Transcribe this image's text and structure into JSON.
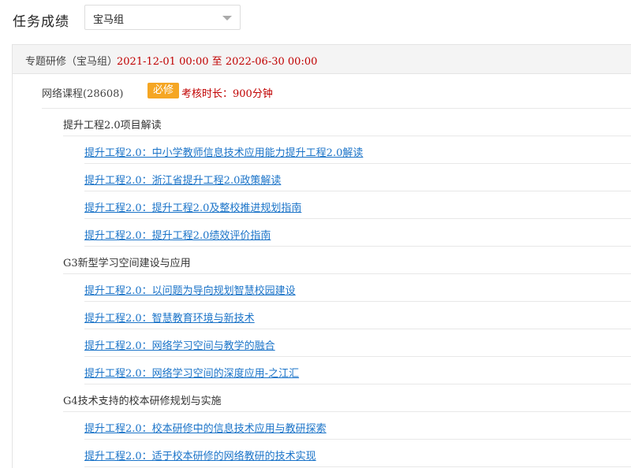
{
  "header": {
    "title": "任务成绩",
    "group_select": {
      "value": "宝马组"
    }
  },
  "project": {
    "label": "专题研修（宝马组）",
    "date_range": "2021-12-01 00:00 至 2022-06-30 00:00",
    "course": {
      "name": "网络课程(28608)",
      "badge": "必修",
      "assessment": "考核时长：900分钟"
    },
    "groups": [
      {
        "title": "提升工程2.0项目解读",
        "lessons": [
          "提升工程2.0：中小学教师信息技术应用能力提升工程2.0解读",
          "提升工程2.0：浙江省提升工程2.0政策解读",
          "提升工程2.0：提升工程2.0及整校推进规划指南",
          "提升工程2.0：提升工程2.0绩效评价指南"
        ]
      },
      {
        "title": "G3新型学习空间建设与应用",
        "lessons": [
          "提升工程2.0：以问题为导向规划智慧校园建设",
          "提升工程2.0：智慧教育环境与新技术",
          "提升工程2.0：网络学习空间与教学的融合",
          "提升工程2.0：网络学习空间的深度应用-之江汇"
        ]
      },
      {
        "title": "G4技术支持的校本研修规划与实施",
        "lessons": [
          "提升工程2.0：校本研修中的信息技术应用与教研探索",
          "提升工程2.0：适于校本研修的网络教研的技术实现"
        ]
      }
    ]
  }
}
